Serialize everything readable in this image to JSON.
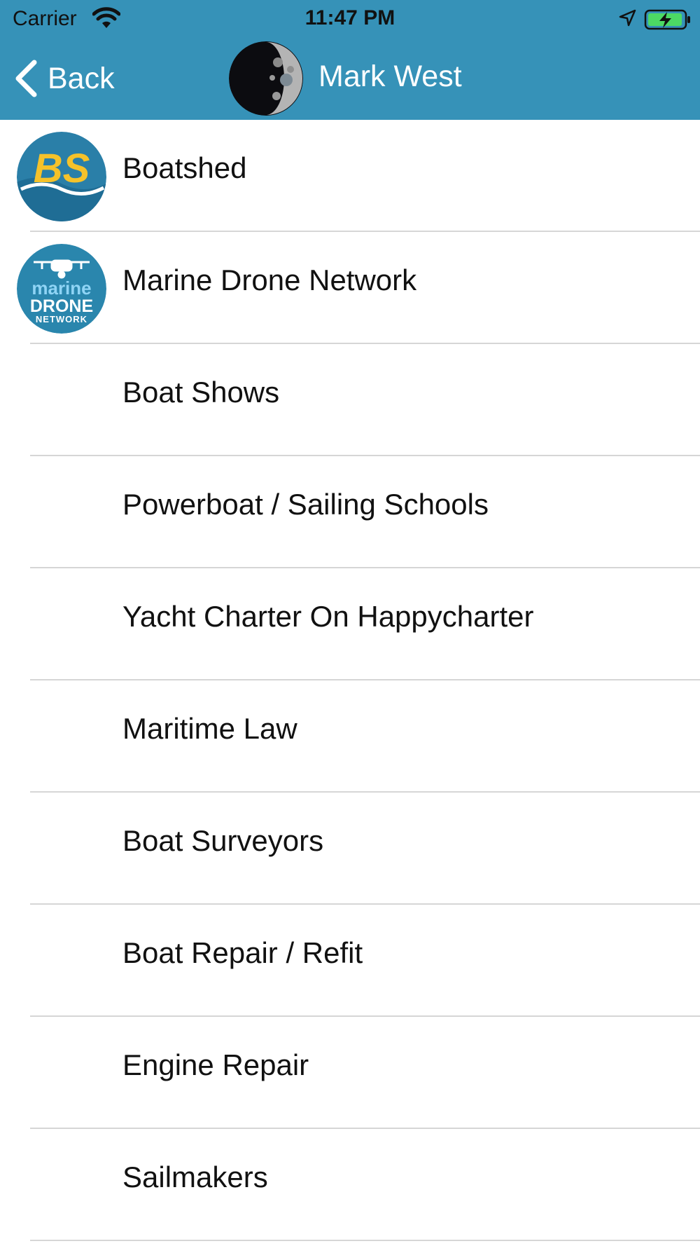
{
  "status_bar": {
    "carrier": "Carrier",
    "time": "11:47 PM",
    "icons": [
      "wifi-icon",
      "location-arrow-icon",
      "battery-charging-icon"
    ]
  },
  "nav_bar": {
    "back_label": "Back",
    "title": "Mark West",
    "background_color": "#3692b8"
  },
  "list": {
    "items": [
      {
        "label": "Boatshed",
        "logo_text": "BS"
      },
      {
        "label": "Marine Drone Network",
        "logo_text": [
          "marine",
          "DRONE",
          "NETWORK"
        ]
      },
      {
        "label": "Boat Shows"
      },
      {
        "label": "Powerboat / Sailing Schools"
      },
      {
        "label": "Yacht Charter On Happycharter"
      },
      {
        "label": "Maritime Law"
      },
      {
        "label": "Boat Surveyors"
      },
      {
        "label": "Boat Repair / Refit"
      },
      {
        "label": "Engine Repair"
      },
      {
        "label": "Sailmakers"
      }
    ]
  }
}
